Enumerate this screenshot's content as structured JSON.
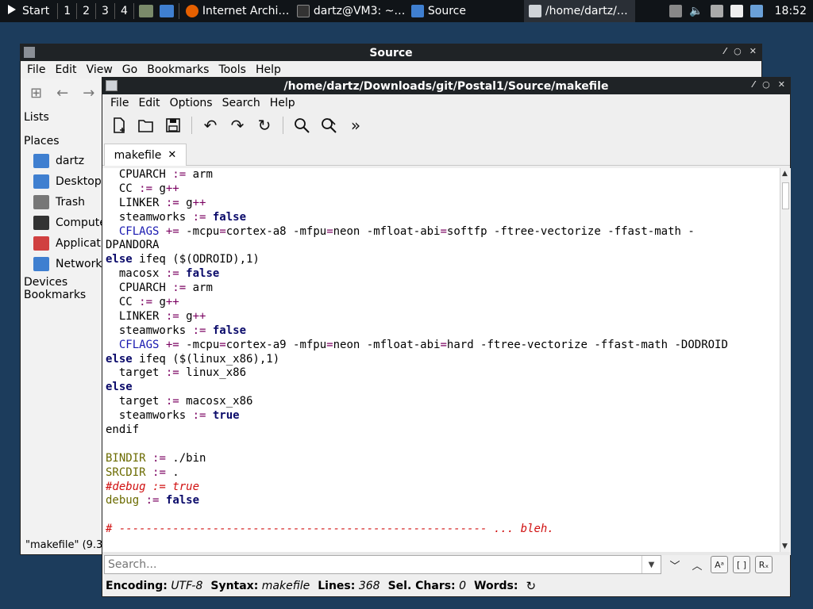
{
  "taskbar": {
    "start_label": "Start",
    "workspaces": [
      "1",
      "2",
      "3",
      "4"
    ],
    "tasks": [
      {
        "label": "Internet Archi…"
      },
      {
        "label": "dartz@VM3: ~…"
      },
      {
        "label": "Source"
      },
      {
        "label": "/home/dartz/…"
      }
    ],
    "clock": "18:52"
  },
  "file_manager": {
    "title": "Source",
    "menu": [
      "File",
      "Edit",
      "View",
      "Go",
      "Bookmarks",
      "Tools",
      "Help"
    ],
    "lists_label": "Lists",
    "places_label": "Places",
    "places": [
      {
        "label": "dartz",
        "icon": "home-folder-icon",
        "color": "#3f7fd0"
      },
      {
        "label": "Desktop",
        "icon": "desktop-icon",
        "color": "#3f7fd0"
      },
      {
        "label": "Trash",
        "icon": "trash-icon",
        "color": "#777777"
      },
      {
        "label": "Compute",
        "icon": "computer-icon",
        "color": "#333333"
      },
      {
        "label": "Applicati",
        "icon": "applications-icon",
        "color": "#d04040"
      },
      {
        "label": "Network",
        "icon": "network-icon",
        "color": "#3f7fd0"
      }
    ],
    "devices_label": "Devices",
    "bookmarks_label": "Bookmarks",
    "status": "\"makefile\" (9.3"
  },
  "editor": {
    "title": "/home/dartz/Downloads/git/Postal1/Source/makefile",
    "menu": [
      "File",
      "Edit",
      "Options",
      "Search",
      "Help"
    ],
    "tab": {
      "label": "makefile",
      "close": "✕"
    },
    "code_lines": [
      [
        {
          "t": "  CPUARCH ",
          "c": ""
        },
        {
          "t": ":=",
          "c": "op"
        },
        {
          "t": " arm",
          "c": ""
        }
      ],
      [
        {
          "t": "  CC ",
          "c": ""
        },
        {
          "t": ":=",
          "c": "op"
        },
        {
          "t": " g",
          "c": ""
        },
        {
          "t": "++",
          "c": "op"
        }
      ],
      [
        {
          "t": "  LINKER ",
          "c": ""
        },
        {
          "t": ":=",
          "c": "op"
        },
        {
          "t": " g",
          "c": ""
        },
        {
          "t": "++",
          "c": "op"
        }
      ],
      [
        {
          "t": "  steamworks ",
          "c": ""
        },
        {
          "t": ":=",
          "c": "op"
        },
        {
          "t": " ",
          "c": ""
        },
        {
          "t": "false",
          "c": "kw"
        }
      ],
      [
        {
          "t": "  CFLAGS ",
          "c": "cfl"
        },
        {
          "t": "+=",
          "c": "op"
        },
        {
          "t": " -m",
          "c": ""
        },
        {
          "t": "cpu",
          "c": ""
        },
        {
          "t": "=",
          "c": "op"
        },
        {
          "t": "cortex-a8 -mfpu",
          "c": ""
        },
        {
          "t": "=",
          "c": "op"
        },
        {
          "t": "neon -mfloat-abi",
          "c": ""
        },
        {
          "t": "=",
          "c": "op"
        },
        {
          "t": "softfp -ftree-vectorize -ffast-math -",
          "c": ""
        }
      ],
      [
        {
          "t": "DPANDORA",
          "c": ""
        }
      ],
      [
        {
          "t": "else",
          "c": "kw"
        },
        {
          "t": " ifeq ($(ODROID),1)",
          "c": ""
        }
      ],
      [
        {
          "t": "  macosx ",
          "c": ""
        },
        {
          "t": ":=",
          "c": "op"
        },
        {
          "t": " ",
          "c": ""
        },
        {
          "t": "false",
          "c": "kw"
        }
      ],
      [
        {
          "t": "  CPUARCH ",
          "c": ""
        },
        {
          "t": ":=",
          "c": "op"
        },
        {
          "t": " arm",
          "c": ""
        }
      ],
      [
        {
          "t": "  CC ",
          "c": ""
        },
        {
          "t": ":=",
          "c": "op"
        },
        {
          "t": " g",
          "c": ""
        },
        {
          "t": "++",
          "c": "op"
        }
      ],
      [
        {
          "t": "  LINKER ",
          "c": ""
        },
        {
          "t": ":=",
          "c": "op"
        },
        {
          "t": " g",
          "c": ""
        },
        {
          "t": "++",
          "c": "op"
        }
      ],
      [
        {
          "t": "  steamworks ",
          "c": ""
        },
        {
          "t": ":=",
          "c": "op"
        },
        {
          "t": " ",
          "c": ""
        },
        {
          "t": "false",
          "c": "kw"
        }
      ],
      [
        {
          "t": "  CFLAGS ",
          "c": "cfl"
        },
        {
          "t": "+=",
          "c": "op"
        },
        {
          "t": " -mcpu",
          "c": ""
        },
        {
          "t": "=",
          "c": "op"
        },
        {
          "t": "cortex-a9 -mfpu",
          "c": ""
        },
        {
          "t": "=",
          "c": "op"
        },
        {
          "t": "neon -mfloat-abi",
          "c": ""
        },
        {
          "t": "=",
          "c": "op"
        },
        {
          "t": "hard -ftree-vectorize -ffast-math -DODROID",
          "c": ""
        }
      ],
      [
        {
          "t": "else",
          "c": "kw"
        },
        {
          "t": " ifeq ($(linux_x86),1)",
          "c": ""
        }
      ],
      [
        {
          "t": "  target ",
          "c": ""
        },
        {
          "t": ":=",
          "c": "op"
        },
        {
          "t": " linux_x86",
          "c": ""
        }
      ],
      [
        {
          "t": "else",
          "c": "kw"
        }
      ],
      [
        {
          "t": "  target ",
          "c": ""
        },
        {
          "t": ":=",
          "c": "op"
        },
        {
          "t": " macosx_x86",
          "c": ""
        }
      ],
      [
        {
          "t": "  steamworks ",
          "c": ""
        },
        {
          "t": ":=",
          "c": "op"
        },
        {
          "t": " ",
          "c": ""
        },
        {
          "t": "true",
          "c": "kw"
        }
      ],
      [
        {
          "t": "endif",
          "c": ""
        }
      ],
      [
        {
          "t": "",
          "c": ""
        }
      ],
      [
        {
          "t": "BINDIR",
          "c": "var"
        },
        {
          "t": " ",
          "c": ""
        },
        {
          "t": ":=",
          "c": "op"
        },
        {
          "t": " ./bin",
          "c": ""
        }
      ],
      [
        {
          "t": "SRCDIR",
          "c": "var"
        },
        {
          "t": " ",
          "c": ""
        },
        {
          "t": ":=",
          "c": "op"
        },
        {
          "t": " .",
          "c": ""
        }
      ],
      [
        {
          "t": "#debug := true",
          "c": "cmt"
        }
      ],
      [
        {
          "t": "debug",
          "c": "var"
        },
        {
          "t": " ",
          "c": ""
        },
        {
          "t": ":=",
          "c": "op"
        },
        {
          "t": " ",
          "c": ""
        },
        {
          "t": "false",
          "c": "kw"
        }
      ],
      [
        {
          "t": "",
          "c": ""
        }
      ],
      [
        {
          "t": "# ------------------------------------------------------- ... bleh.",
          "c": "cmt"
        }
      ]
    ],
    "search": {
      "placeholder": "Search...",
      "value": ""
    },
    "status": {
      "encoding_label": "Encoding:",
      "encoding": "UTF-8",
      "syntax_label": "Syntax:",
      "syntax": "makefile",
      "lines_label": "Lines:",
      "lines": "368",
      "selchars_label": "Sel. Chars:",
      "selchars": "0",
      "words_label": "Words:"
    }
  },
  "colors": {
    "desktop": "#1c3c5c",
    "titlebar": "#1f2326",
    "keyword": "#0a0a6a",
    "variable": "#6b6b00",
    "operator": "#7a0060",
    "comment": "#d01010"
  }
}
